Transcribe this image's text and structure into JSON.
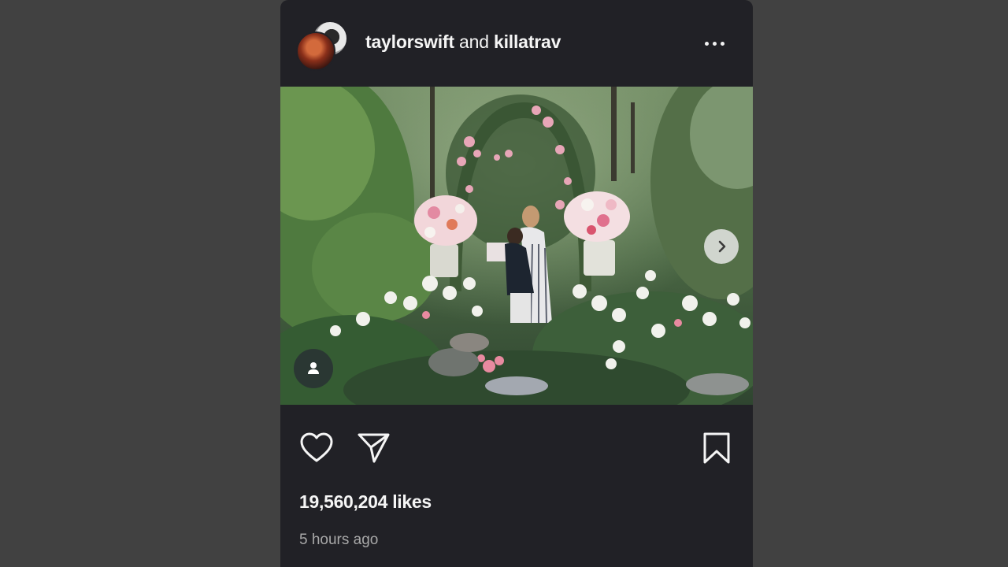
{
  "post": {
    "user_primary": "taylorswift",
    "conjunction": "and",
    "user_secondary": "killatrav",
    "likes_text": "19,560,204 likes",
    "time_text": "5 hours ago"
  },
  "icons": {
    "more": "more-options-icon",
    "next": "chevron-right-icon",
    "tag": "user-tag-icon",
    "like": "heart-icon",
    "share": "send-icon",
    "save": "bookmark-icon"
  },
  "colors": {
    "page_background": "#414141",
    "card_background": "#212126",
    "text_primary": "#f5f5f5",
    "text_secondary": "#a8a8a8"
  }
}
